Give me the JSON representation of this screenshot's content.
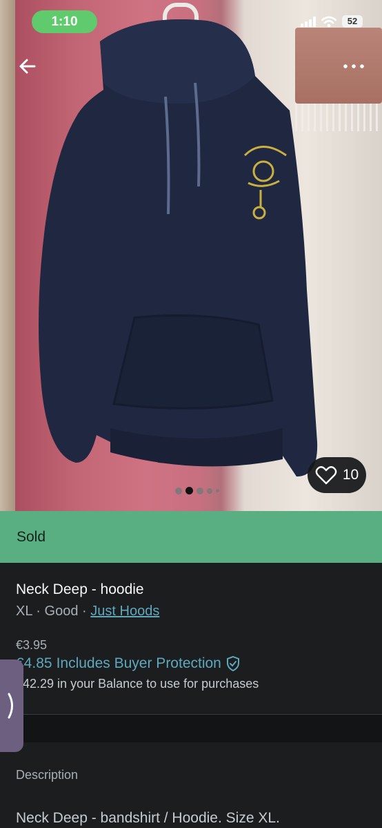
{
  "status_bar": {
    "time": "1:10",
    "battery": "52"
  },
  "photo": {
    "likes": "10",
    "carousel": {
      "count": 5,
      "active_index": 1
    }
  },
  "listing": {
    "status": "Sold",
    "title": "Neck Deep - hoodie",
    "size": "XL",
    "condition": "Good",
    "brand": "Just Hoods",
    "separator": "·",
    "price": "€3.95",
    "protection_price": "€4.85",
    "protection_label": "Includes Buyer Protection",
    "balance_note": "€42.29 in your Balance to use for purchases"
  },
  "description": {
    "label": "Description",
    "text": "Neck Deep - bandshirt / Hoodie. Size XL."
  },
  "icons": [
    "back-arrow-icon",
    "more-icon",
    "heart-icon",
    "shield-check-icon",
    "chevron-right-icon"
  ],
  "colors": {
    "sold_banner": "#5aaf82",
    "link": "#5fa8bd",
    "status_time": "#5fcb6d",
    "background": "#1b1d1f"
  }
}
